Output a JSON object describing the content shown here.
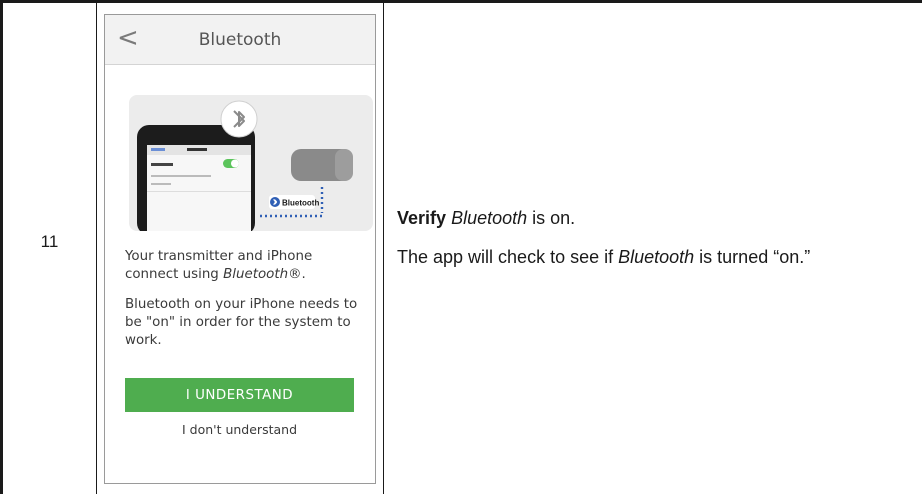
{
  "step": {
    "number": "11"
  },
  "phone": {
    "nav_title": "Bluetooth",
    "back_glyph": "<",
    "illustration": {
      "settings_back_label": "Settings",
      "settings_title": "Bluetooth",
      "settings_row_label": "Bluetooth",
      "badge_label": "Bluetooth",
      "icons": [
        "bluetooth-icon",
        "iphone-icon",
        "transmitter-icon",
        "toggle-icon"
      ]
    },
    "paragraph_1_start": "Your transmitter and iPhone connect using ",
    "paragraph_1_em": "Bluetooth®",
    "paragraph_1_end": ".",
    "paragraph_2": "Bluetooth on your iPhone needs to be \"on\" in order for the system to work.",
    "primary_button_label": "I UNDERSTAND",
    "secondary_link_label": "I don't understand",
    "colors": {
      "button_green": "#4fad4f",
      "nav_bg": "#f2f2f2"
    }
  },
  "instructions": {
    "verify_bold": "Verify",
    "verify_em": "Bluetooth",
    "verify_rest": " is on.",
    "check_start": "The app will check to see if ",
    "check_em": "Bluetooth",
    "check_end": " is turned “on.”"
  }
}
